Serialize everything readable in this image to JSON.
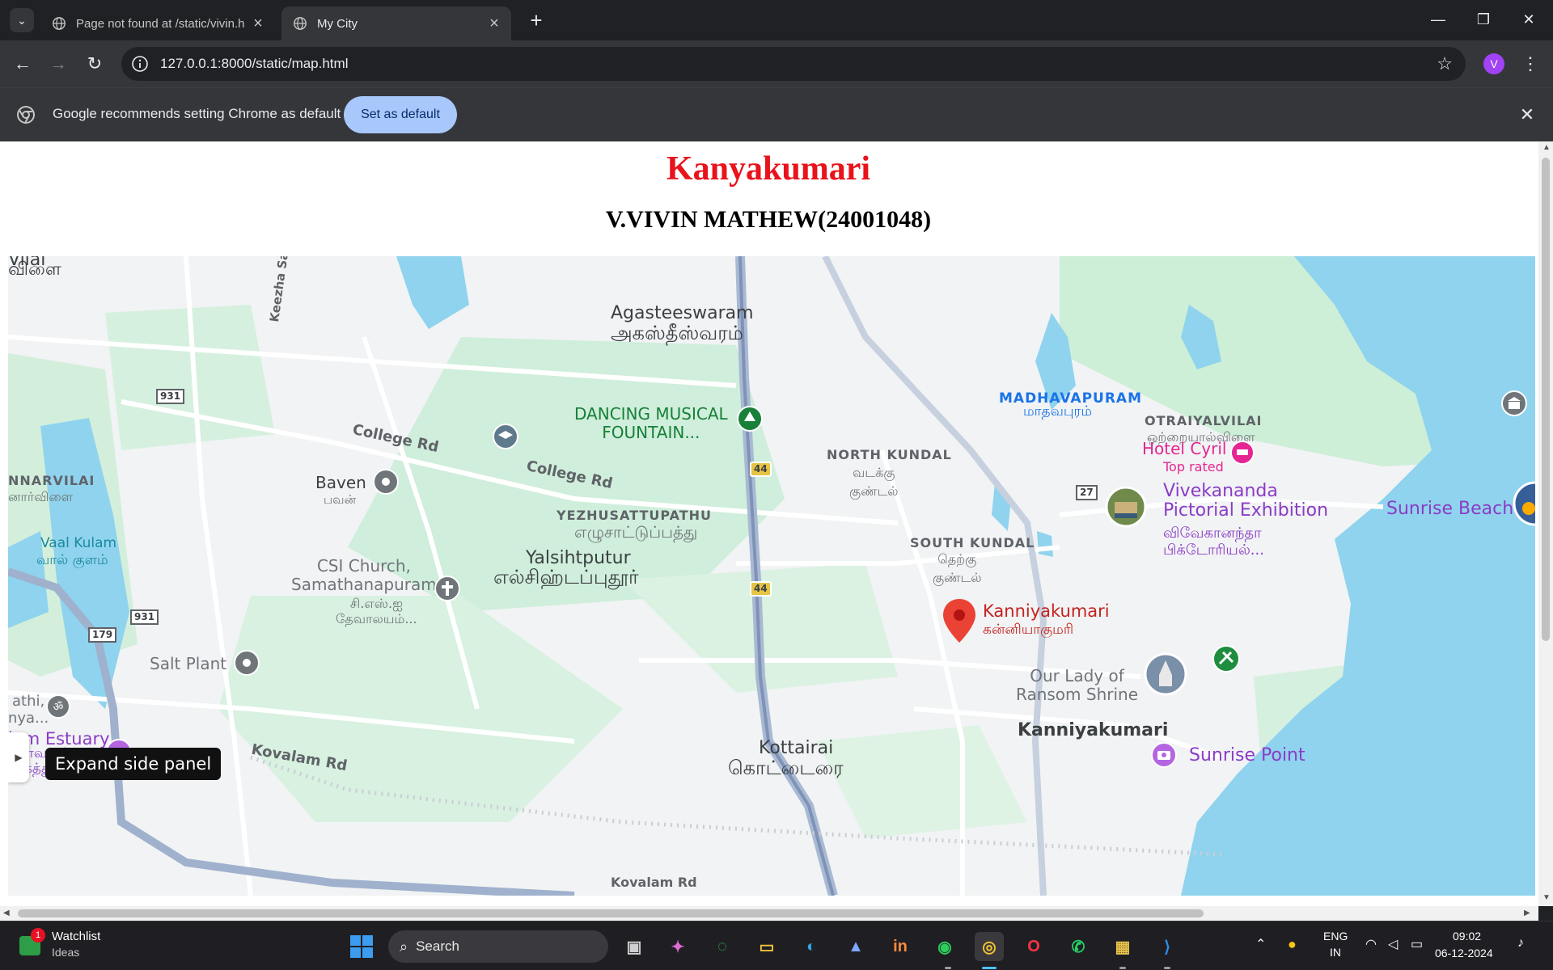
{
  "browser": {
    "tabs": [
      {
        "title": "Page not found at /static/vivin.h",
        "active": false
      },
      {
        "title": "My City",
        "active": true
      }
    ],
    "url": "127.0.0.1:8000/static/map.html",
    "profile_initial": "V",
    "infobar": {
      "message": "Google recommends setting Chrome as default",
      "button": "Set as default"
    }
  },
  "page": {
    "title": "Kanyakumari",
    "subtitle": "V.VIVIN MATHEW(24001048)"
  },
  "map": {
    "labels": {
      "agasteeswaram": "Agasteeswaram",
      "agasteeswaram_ta": "அகஸ்தீஸ்வரம்",
      "dancing_fountain": "DANCING MUSICAL\nFOUNTAIN...",
      "college_rd": "College Rd",
      "baven": "Baven",
      "baven_ta": "பவன்",
      "north_kundal": "NORTH KUNDAL",
      "north_kundal_ta": "வடக்கு\nகுண்டல்",
      "madhavapuram": "MADHAVAPURAM",
      "madhavapuram_ta": "மாதவபுரம்",
      "otraiyalvilai": "OTRAIYALVILAI",
      "otraiyalvilai_ta": "ஒற்றையால்விளை",
      "hotel_cyril": "Hotel Cyril",
      "hotel_cyril_sub": "Top rated",
      "vivekananda": "Vivekananda\nPictorial Exhibition",
      "vivekananda_ta": "விவேகானந்தா\nபிக்டோரியல்...",
      "sunrise_beach": "Sunrise Beach",
      "yezhusattupathu": "YEZHUSATTUPATHU",
      "yezhusattupathu_ta": "எழுசாட்டுப்பத்து",
      "yalsihtputur": "Yalsihtputur",
      "yalsihtputur_ta": "எல்சிஹ்டப்புதூர்",
      "south_kundal": "SOUTH KUNDAL",
      "south_kundal_ta": "தெற்கு\nகுண்டல்",
      "narvilai": "NNARVILAI",
      "narvilai_ta": "னார்விளை",
      "vaal_kulam": "Vaal Kulam",
      "vaal_kulam_ta": "வால் குளம்",
      "csi_church": "CSI Church,\nSamathanapuram",
      "csi_church_ta": "சி.எஸ்.ஐ\nதேவாலயம்...",
      "kanniyakumari_pin": "Kanniyakumari",
      "kanniyakumari_pin_ta": "கன்னியாகுமரி",
      "salt_plant": "Salt Plant",
      "our_lady": "Our Lady of\nRansom Shrine",
      "kanniyakumari": "Kanniyakumari",
      "estuary": "lam Estuary",
      "estuary_ta": "கோவளம்\nமுகத்துவாரம்",
      "athi": "athi,\nnya...",
      "kottairai": "Kottairai",
      "kottairai_ta": "கொட்டைரை",
      "kovalam_rd": "Kovalam Rd",
      "kovalam_rd2": "Kovalam Rd",
      "sunrise_point": "Sunrise Point",
      "keezha_salai": "Keezha Salai",
      "vilai_top": "விளை",
      "vilai_top2": "Vilai"
    },
    "road_shields": [
      "931",
      "44",
      "44",
      "27",
      "931",
      "179"
    ],
    "tooltip": "Expand side panel"
  },
  "taskbar": {
    "watchlist_title": "Watchlist",
    "watchlist_sub": "Ideas",
    "watchlist_badge": "1",
    "search_placeholder": "Search",
    "language": "ENG",
    "region": "IN",
    "time": "09:02",
    "date": "06-12-2024"
  }
}
